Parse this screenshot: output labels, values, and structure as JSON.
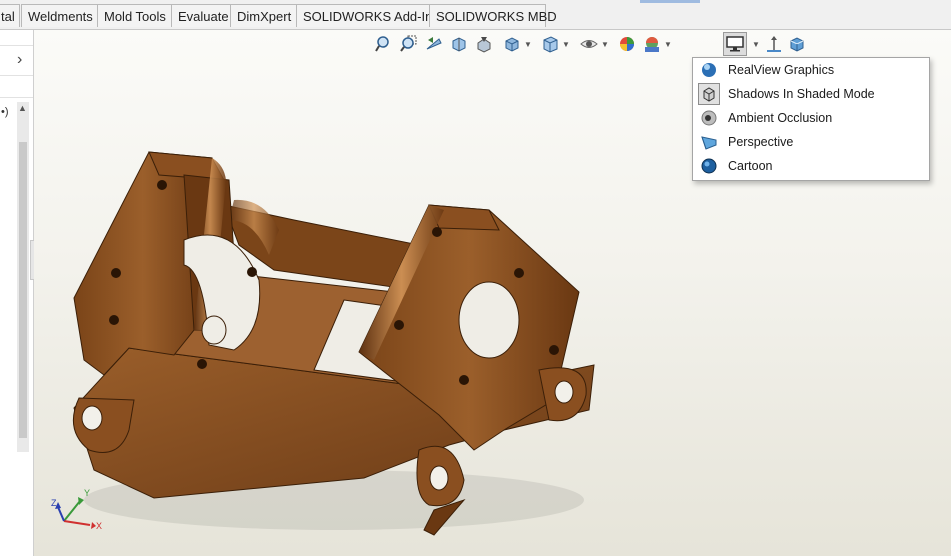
{
  "tabs": [
    {
      "label": "tal"
    },
    {
      "label": "Weldments"
    },
    {
      "label": "Mold Tools"
    },
    {
      "label": "Evaluate"
    },
    {
      "label": "DimXpert"
    },
    {
      "label": "SOLIDWORKS Add-Ins"
    },
    {
      "label": "SOLIDWORKS MBD"
    }
  ],
  "left_pane": {
    "partial_text": "•)"
  },
  "display_menu": {
    "items": [
      {
        "label": "RealView Graphics",
        "icon": "realview-sphere-icon"
      },
      {
        "label": "Shadows In Shaded Mode",
        "icon": "shadows-cube-icon",
        "checked": true
      },
      {
        "label": "Ambient Occlusion",
        "icon": "ambient-occlusion-icon"
      },
      {
        "label": "Perspective",
        "icon": "perspective-box-icon"
      },
      {
        "label": "Cartoon",
        "icon": "cartoon-sphere-icon"
      }
    ]
  },
  "triad": {
    "x": "X",
    "y": "Y",
    "z": "Z"
  },
  "colors": {
    "part": "#8a5326",
    "part_light": "#b87a3c",
    "part_dark": "#4a2a10"
  }
}
